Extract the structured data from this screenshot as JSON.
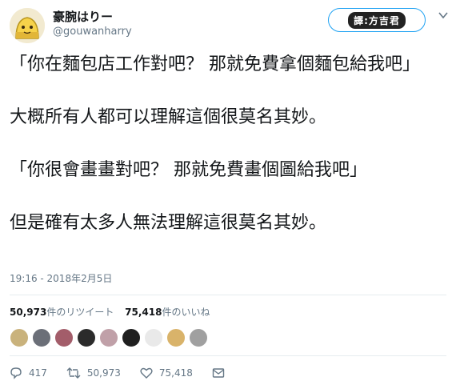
{
  "author": {
    "display_name": "豪腕はりー",
    "handle": "@gouwanharry"
  },
  "follow_badge": "譯:方吉君",
  "tweet": {
    "paragraphs": [
      "「你在麵包店工作對吧？ 那就免費拿個麵包給我吧」",
      "大概所有人都可以理解這個很莫名其妙。",
      "「你很會畫畫對吧？ 那就免費畫個圖給我吧」",
      "但是確有太多人無法理解這很莫名其妙。"
    ],
    "timestamp": "19:16 - 2018年2月5日"
  },
  "stats": {
    "retweets_count": "50,973",
    "retweets_label": "件のリツイート",
    "likes_count": "75,418",
    "likes_label": "件のいいね"
  },
  "liker_avatars": [
    "#c9b27c",
    "#6b6f78",
    "#a35d6a",
    "#2b2b2b",
    "#c0a0a8",
    "#1f1f1f",
    "#e9e9e9",
    "#d9b36a",
    "#a0a0a0"
  ],
  "actions": {
    "replies": "417",
    "retweets": "50,973",
    "likes": "75,418"
  },
  "colors": {
    "accent": "#1da1f2",
    "secondary_text": "#657786"
  }
}
